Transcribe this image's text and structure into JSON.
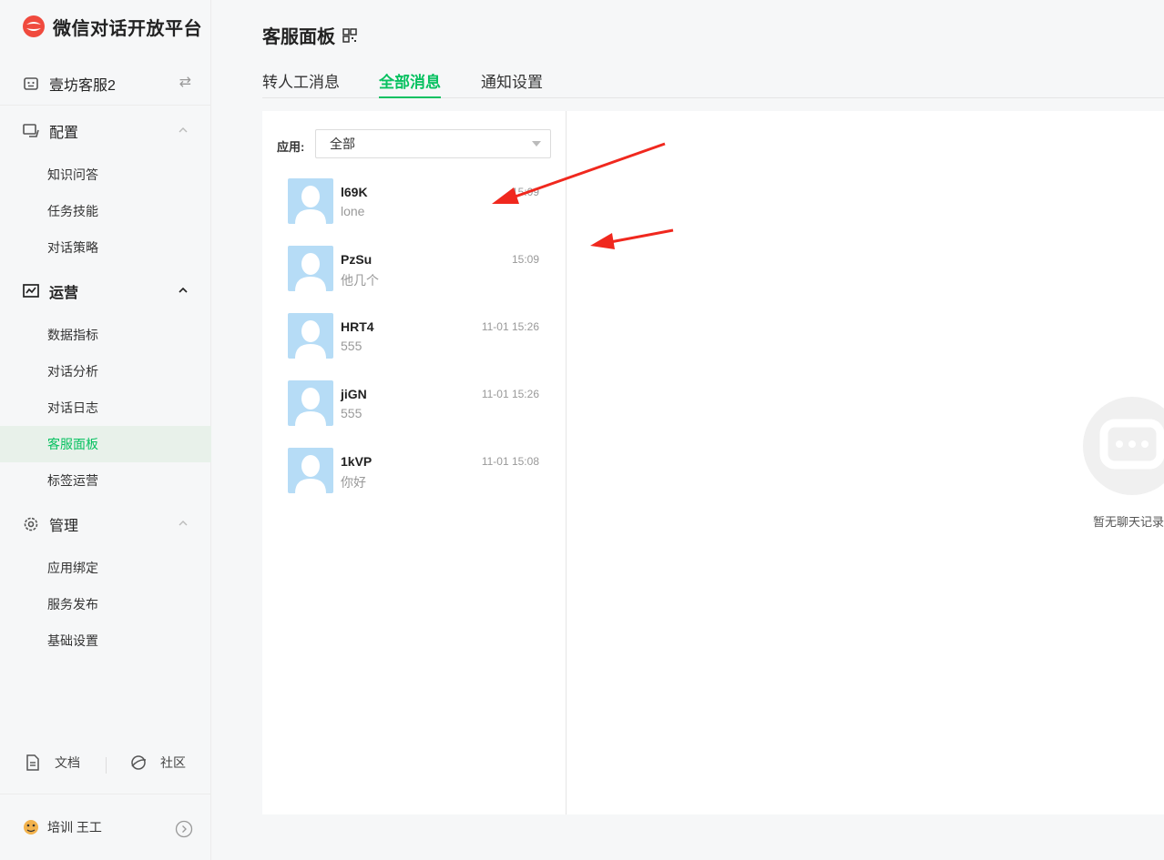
{
  "sidebar": {
    "logo_text": "微信对话开放平台",
    "account_name": "壹坊客服2",
    "groups": [
      {
        "label": "配置",
        "items": [
          "知识问答",
          "任务技能",
          "对话策略"
        ]
      },
      {
        "label": "运营",
        "items": [
          "数据指标",
          "对话分析",
          "对话日志",
          "客服面板",
          "标签运营"
        ]
      },
      {
        "label": "管理",
        "items": [
          "应用绑定",
          "服务发布",
          "基础设置"
        ]
      }
    ],
    "active_item": "客服面板",
    "bottom": {
      "docs_label": "文档",
      "community_label": "社区"
    },
    "user_name": "培训 王工"
  },
  "main": {
    "title": "客服面板",
    "tabs": [
      {
        "label": "转人工消息",
        "active": false
      },
      {
        "label": "全部消息",
        "active": true
      },
      {
        "label": "通知设置",
        "active": false
      }
    ],
    "filter": {
      "label": "应用:",
      "value": "全部"
    },
    "conversations": [
      {
        "name": "l69K",
        "message": "lone",
        "time": "15:09"
      },
      {
        "name": "PzSu",
        "message": "他几个",
        "time": "15:09"
      },
      {
        "name": "HRT4",
        "message": "555",
        "time": "11-01 15:26"
      },
      {
        "name": "jiGN",
        "message": "555",
        "time": "11-01 15:26"
      },
      {
        "name": "1kVP",
        "message": "你好",
        "time": "11-01 15:08"
      }
    ],
    "empty_text": "暂无聊天记录"
  },
  "colors": {
    "accent": "#07c160",
    "avatar_bg": "#b6dcf6",
    "annotation": "#f0281e"
  }
}
